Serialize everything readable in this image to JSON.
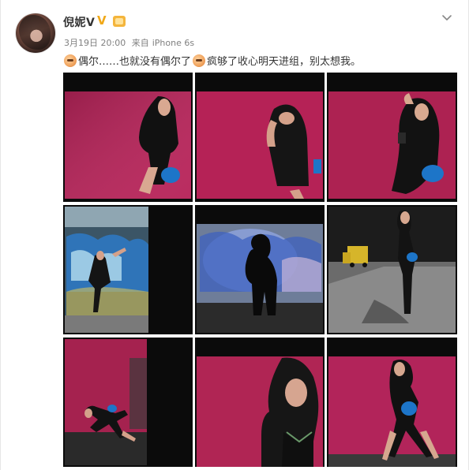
{
  "user": {
    "name": "倪妮V",
    "verified_badge": "V",
    "badge_color": "#f0a818"
  },
  "meta": {
    "date": "3月19日 20:00",
    "source_prefix": "来自",
    "source": "iPhone 6s"
  },
  "post": {
    "segment1": "偶尔……也就没有偶尔了",
    "segment2": "疯够了收心明天进组，别太想我。"
  },
  "photos": [
    {
      "name": "photo-1",
      "scene": "woman-against-red-wall"
    },
    {
      "name": "photo-2",
      "scene": "woman-leaning-red-wall"
    },
    {
      "name": "photo-3",
      "scene": "woman-red-wall-blue-bag"
    },
    {
      "name": "photo-4",
      "scene": "woman-graffiti-wall"
    },
    {
      "name": "photo-5",
      "scene": "silhouette-graffiti-wall"
    },
    {
      "name": "photo-6",
      "scene": "woman-on-street-yellow-truck"
    },
    {
      "name": "photo-7",
      "scene": "woman-crouching-red-wall"
    },
    {
      "name": "photo-8",
      "scene": "woman-closeup-red-wall"
    },
    {
      "name": "photo-9",
      "scene": "woman-posing-red-wall"
    }
  ],
  "colors": {
    "wall": "#b8245a",
    "film_black": "#0b0b0b",
    "bag_blue": "#1d75c8"
  }
}
